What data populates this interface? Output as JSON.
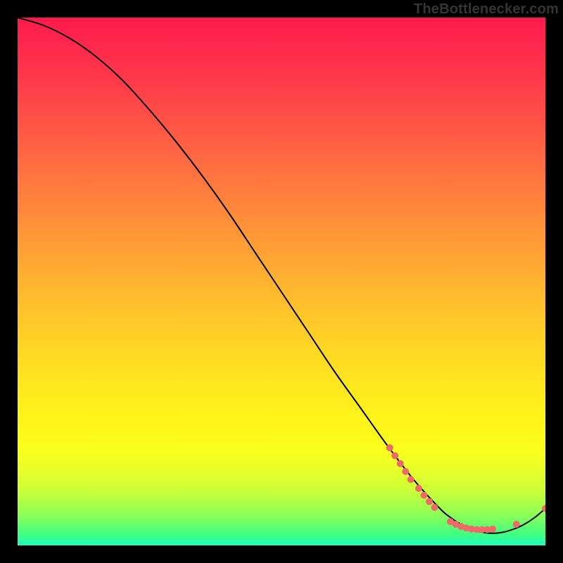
{
  "credit": "TheBottlenecker.com",
  "chart_data": {
    "type": "line",
    "title": "",
    "xlabel": "",
    "ylabel": "",
    "xlim": [
      0,
      100
    ],
    "ylim": [
      0,
      100
    ],
    "grid": false,
    "legend": false,
    "series": [
      {
        "name": "curve",
        "stroke": "#000000",
        "x": [
          0,
          5,
          10,
          15,
          20,
          25,
          30,
          35,
          40,
          45,
          50,
          55,
          60,
          65,
          70,
          75,
          80,
          82,
          84,
          86,
          88,
          90,
          92,
          94,
          96,
          98,
          100
        ],
        "y": [
          100,
          98.5,
          96,
          92.5,
          88,
          82.5,
          76.5,
          70,
          63,
          55.5,
          48,
          40.5,
          33,
          26,
          19,
          12.5,
          7,
          5.3,
          4,
          3.1,
          2.5,
          2.3,
          2.5,
          3.1,
          4,
          5.3,
          7
        ]
      }
    ],
    "markers": [
      {
        "name": "dot",
        "color": "#ed6a66",
        "x": 70.5,
        "y": 18.5,
        "r": 5
      },
      {
        "name": "dot",
        "color": "#ed6a66",
        "x": 71.5,
        "y": 17.0,
        "r": 5
      },
      {
        "name": "dot",
        "color": "#ed6a66",
        "x": 72.5,
        "y": 15.5,
        "r": 5
      },
      {
        "name": "dot",
        "color": "#ed6a66",
        "x": 73.5,
        "y": 14.0,
        "r": 5
      },
      {
        "name": "dot",
        "color": "#ed6a66",
        "x": 74.5,
        "y": 12.5,
        "r": 5
      },
      {
        "name": "dot",
        "color": "#ed6a66",
        "x": 76.0,
        "y": 10.8,
        "r": 5
      },
      {
        "name": "dot",
        "color": "#ed6a66",
        "x": 77.0,
        "y": 9.5,
        "r": 5
      },
      {
        "name": "dot",
        "color": "#ed6a66",
        "x": 78.0,
        "y": 8.3,
        "r": 5
      },
      {
        "name": "dot",
        "color": "#ed6a66",
        "x": 79.0,
        "y": 7.2,
        "r": 5
      },
      {
        "name": "dot",
        "color": "#ed6a66",
        "x": 82.0,
        "y": 4.5,
        "r": 5
      },
      {
        "name": "dot",
        "color": "#ed6a66",
        "x": 83.0,
        "y": 4.0,
        "r": 5
      },
      {
        "name": "dot",
        "color": "#ed6a66",
        "x": 84.0,
        "y": 3.6,
        "r": 5
      },
      {
        "name": "dot",
        "color": "#ed6a66",
        "x": 85.0,
        "y": 3.3,
        "r": 5
      },
      {
        "name": "dot",
        "color": "#ed6a66",
        "x": 86.0,
        "y": 3.1,
        "r": 5
      },
      {
        "name": "dot",
        "color": "#ed6a66",
        "x": 87.0,
        "y": 3.0,
        "r": 5
      },
      {
        "name": "dot",
        "color": "#ed6a66",
        "x": 88.0,
        "y": 3.0,
        "r": 5
      },
      {
        "name": "dot",
        "color": "#ed6a66",
        "x": 89.0,
        "y": 3.0,
        "r": 5
      },
      {
        "name": "dot",
        "color": "#ed6a66",
        "x": 90.0,
        "y": 3.1,
        "r": 5
      },
      {
        "name": "dot",
        "color": "#ed6a66",
        "x": 94.5,
        "y": 4.0,
        "r": 5
      },
      {
        "name": "dot",
        "color": "#ed6a66",
        "x": 100.0,
        "y": 7.0,
        "r": 5
      }
    ]
  }
}
